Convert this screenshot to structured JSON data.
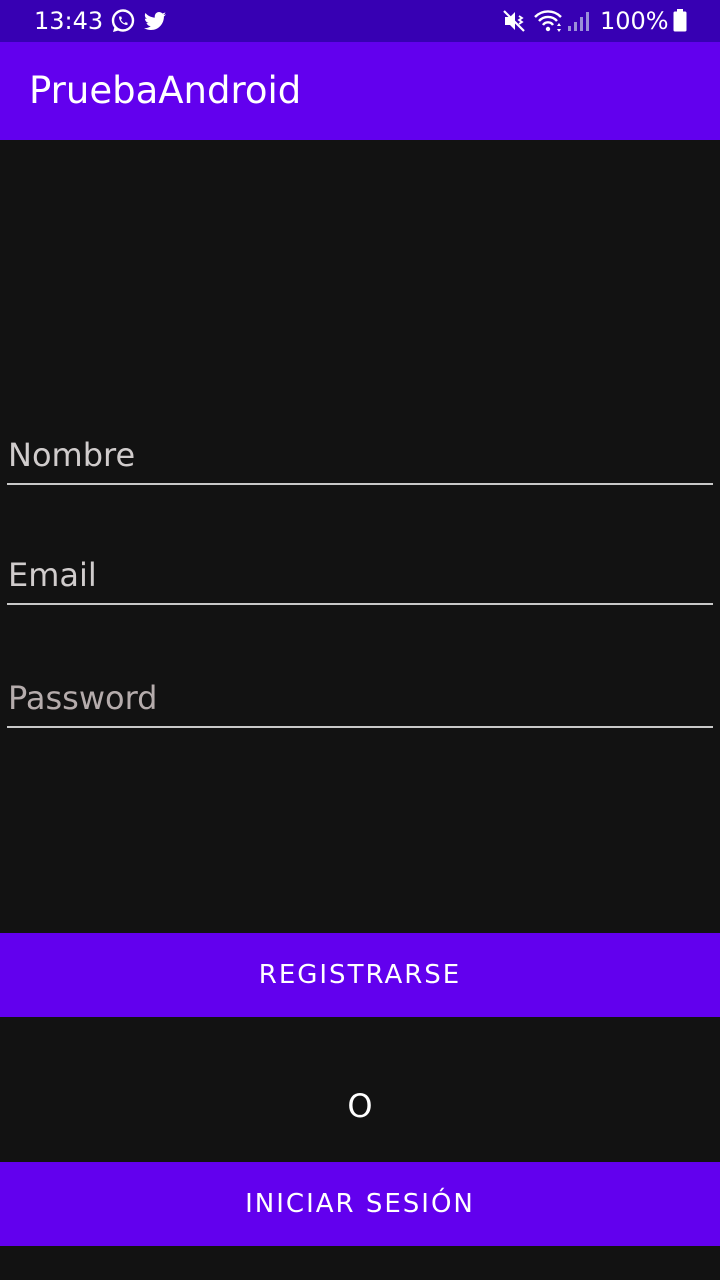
{
  "status_bar": {
    "time": "13:43",
    "battery": "100%",
    "icons": [
      "whatsapp-icon",
      "twitter-icon",
      "mute-vibrate-icon",
      "wifi-icon",
      "signal-icon",
      "battery-icon"
    ]
  },
  "app_bar": {
    "title": "PruebaAndroid"
  },
  "form": {
    "name_placeholder": "Nombre",
    "email_placeholder": "Email",
    "password_placeholder": "Password"
  },
  "actions": {
    "register_label": "REGISTRARSE",
    "or_label": "O",
    "login_label": "INICIAR SESIÓN"
  },
  "colors": {
    "primary": "#6200ee",
    "primary_dark": "#3700b3",
    "background": "#121212",
    "text": "#ffffff"
  }
}
